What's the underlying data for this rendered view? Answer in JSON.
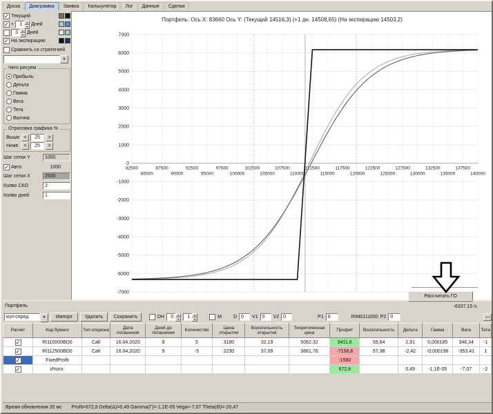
{
  "tabs": {
    "items": [
      {
        "name": "tab-board",
        "label": "Доска",
        "active": false
      },
      {
        "name": "tab-diagram",
        "label": "Диаграмма",
        "active": true
      },
      {
        "name": "tab-order",
        "label": "Заявка",
        "active": false
      },
      {
        "name": "tab-calculator",
        "label": "Калькулятор",
        "active": false
      },
      {
        "name": "tab-log",
        "label": "Лог",
        "active": false
      },
      {
        "name": "tab-data",
        "label": "Данные",
        "active": false
      },
      {
        "name": "tab-trades",
        "label": "Сделки",
        "active": false
      }
    ]
  },
  "left_panel": {
    "series_rows": [
      {
        "name": "current",
        "label": "Текущий",
        "checked": true,
        "prefix": "",
        "spinner": "",
        "swatches": [
          "#6e6e6e",
          "#141414"
        ]
      },
      {
        "name": "plus-1-day",
        "label": "Дней",
        "checked": true,
        "prefix": "+",
        "spinner": "1",
        "swatches": [
          "#a9c6e2",
          "#5c8bc4"
        ]
      },
      {
        "name": "plus-3-days",
        "label": "Дней",
        "checked": false,
        "prefix": "",
        "spinner": "3",
        "swatches": [
          "#dbe5f1",
          "#afc0dc"
        ]
      },
      {
        "name": "expiration",
        "label": "На экспирацию",
        "checked": true,
        "prefix": "",
        "spinner": "",
        "swatches": [
          "#141414",
          "#22365d"
        ]
      }
    ],
    "compare_label": "Сравнить со стратегией",
    "compare_checked": false,
    "draw_group": {
      "title": "Чего рисуем",
      "options": [
        {
          "name": "profit",
          "label": "Прибыль",
          "selected": true
        },
        {
          "name": "delta",
          "label": "Дельта",
          "selected": false
        },
        {
          "name": "gamma",
          "label": "Гамма",
          "selected": false
        },
        {
          "name": "vega",
          "label": "Вега",
          "selected": false
        },
        {
          "name": "theta",
          "label": "Тета",
          "selected": false
        },
        {
          "name": "volna",
          "label": "Волчна",
          "selected": false
        }
      ]
    },
    "render_group": {
      "title": "Отрисовка графика %",
      "dec_label": "<",
      "inc_label": ">",
      "rows": [
        {
          "name": "above",
          "label": "Выше",
          "value": "25"
        },
        {
          "name": "below",
          "label": "Ниже",
          "value": "25"
        }
      ]
    },
    "grid_y_label": "Шаг сетки Y",
    "grid_y_value": "1000",
    "auto_label": "Авто",
    "auto_checked": true,
    "auto_value": "1000",
    "grid_x_label": "Шаг сетки X",
    "grid_x_value": "2500",
    "sko_label": "Колво СКО",
    "sko_value": "2",
    "days_count_label": "Колво дней",
    "days_count_value": "1"
  },
  "chart": {
    "title": "Портфель: Ось X: 83660 Ось Y:  (Текущий 14516,3)  (+1 дн. 14508,65)  (На экспирацию 14503,2)",
    "x_min": 82500,
    "x_max": 140000,
    "y_min": -7000,
    "y_max": 7000,
    "y_step": 1000,
    "x_label_step": 5000,
    "x_labels_upper_start": 82500,
    "x_labels_lower_start": 85000,
    "current_price": 111300,
    "sd_lines": [
      102800,
      119800
    ],
    "sd_color": "#dca8b2",
    "price_line_color": "#b3b3b3",
    "curves": {
      "expiration": {
        "low": -6330,
        "high": 6170,
        "k1": 110000,
        "k2": 112500,
        "color": "#141414"
      },
      "current": {
        "low": -6335,
        "high": 6200,
        "center": 112200,
        "scale": 5000,
        "color": "#5f5f5f"
      },
      "plus1": {
        "low": -6335,
        "high": 6200,
        "center": 111900,
        "scale": 4600,
        "color": "#9fb0c4"
      }
    }
  },
  "calc": {
    "button_label": "Рассчитать ГО",
    "value": "-6337,15 п."
  },
  "portfolio": {
    "title": "Портфель",
    "toolbar": {
      "strategy_value": "кол-спред",
      "import_label": "Импорт",
      "delete_label": "Удалить",
      "save_label": "Сохранить",
      "dh_label": "DH",
      "dh_checked": false,
      "dh_spin1": "0",
      "dh_spin2": "1",
      "m_label": "M",
      "m_checked": false,
      "d_label": "D",
      "d_value": "0",
      "v1_label": "V1",
      "v1_value": "0",
      "v2_label": "V2",
      "v2_value": "0",
      "p1_label": "P1",
      "p1_value": "0",
      "rim_label": "RIM0111650",
      "p2_label": "P2",
      "p2_value": "0",
      "collapse_label": "—"
    },
    "table": {
      "columns": [
        "Расчет",
        "Код бумаги",
        "Тип опциона",
        "Дата погашения",
        "Дней до погашения",
        "Количество",
        "Цена открытия",
        "Волатильность открытия",
        "Теоретическая цена",
        "Профит",
        "Волатильность",
        "Дельта",
        "Гамма",
        "Вега",
        "Тета"
      ],
      "rows": [
        {
          "checked": true,
          "checkbox_highlight": false,
          "profit_class": "pos",
          "cells": [
            "RI110000BD0",
            "Call",
            "16.04.2020",
            "9",
            "5",
            "3180",
            "32,19",
            "5062,32",
            "9411,6",
            "59,64",
            "2,91",
            "0,000185",
            "346,34",
            "-1"
          ]
        },
        {
          "checked": true,
          "checkbox_highlight": false,
          "profit_class": "neg",
          "cells": [
            "RI112500BD0",
            "Call",
            "16.04.2020",
            "9",
            "-5",
            "2230",
            "37,09",
            "3661,76",
            "-7158,8",
            "57,38",
            "-2,42",
            "-0,000196",
            "-353,41",
            "1"
          ]
        },
        {
          "checked": true,
          "checkbox_highlight": true,
          "profit_class": "neg",
          "cells": [
            "FixedProfit",
            "",
            "",
            "",
            "",
            "",
            "",
            "",
            "-1580",
            "",
            "",
            "",
            "",
            ""
          ]
        },
        {
          "checked": true,
          "checkbox_highlight": false,
          "profit_class": "pos",
          "cells": [
            "Итого:",
            "",
            "",
            "",
            "",
            "",
            "",
            "",
            "672,8",
            "",
            "0,49",
            "-1,1E-05",
            "-7,07",
            "-2"
          ]
        }
      ]
    }
  },
  "status_bar": {
    "left": "Время обновления 20 мс",
    "right": "Profit=672,8 Delta(Δ)=0,49 Gamma(Γ)=-1,1E-05 Vega=-7,07 Theta(Θ)=-20,47"
  },
  "colors": {
    "profit_pos": "#9fe89f",
    "profit_neg": "#f2a8a8",
    "select_blue": "#3a6cb5"
  }
}
